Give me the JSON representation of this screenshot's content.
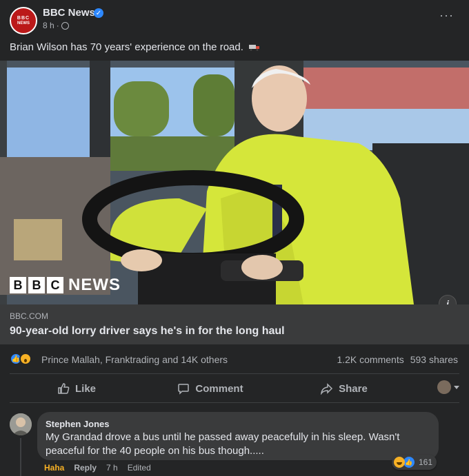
{
  "post": {
    "page_name": "BBC News",
    "avatar_top": "BBC",
    "avatar_bottom": "NEWS",
    "time": "8 h",
    "meta_sep": "·",
    "caption": "Brian Wilson has 70 years' experience on the road.",
    "more": "···"
  },
  "image": {
    "watermark_letters": [
      "B",
      "B",
      "C"
    ],
    "watermark_word": "NEWS",
    "info_label": "i"
  },
  "link": {
    "domain": "BBC.COM",
    "headline": "90-year-old lorry driver says he's in for the long haul"
  },
  "stats": {
    "reaction_names": "Prince Mallah, Franktrading and 14K others",
    "comments": "1.2K comments",
    "shares": "593 shares"
  },
  "actions": {
    "like": "Like",
    "comment": "Comment",
    "share": "Share"
  },
  "comment": {
    "author": "Stephen Jones",
    "text": "My Grandad drove a bus until he passed away peacefully in his sleep. Wasn't peaceful for the 40 people on his bus though.....",
    "reaction_count": "161",
    "haha": "Haha",
    "reply": "Reply",
    "time": "7 h",
    "edited": "Edited"
  },
  "colors": {
    "background": "#242526",
    "link_box": "#3a3b3c",
    "accent_blue": "#2d88ff",
    "bbc_red": "#bb1919",
    "haha_yellow": "#f7b125"
  }
}
